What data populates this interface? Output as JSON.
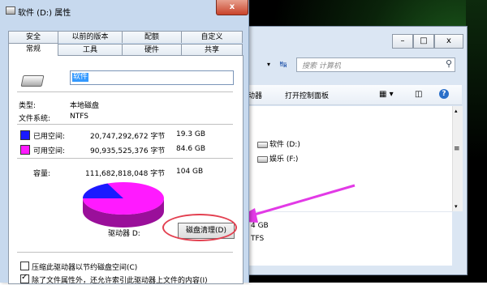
{
  "explorer": {
    "search_placeholder": "搜索 计算机",
    "controls": {
      "minimize": "–",
      "maximize": "□",
      "close": "x"
    },
    "address_dropdown": "▾",
    "refresh": "↹",
    "toolbar": {
      "partial_item": "动器",
      "control_panel": "打开控制面板"
    },
    "drives": [
      {
        "label": "软件 (D:)"
      },
      {
        "label": "娱乐 (F:)"
      }
    ],
    "details_pane": {
      "size_fragment": "4 GB",
      "fs_fragment": "TFS"
    }
  },
  "dialog": {
    "title": "软件 (D:) 属性",
    "close": "x",
    "tabs_top": [
      "安全",
      "以前的版本",
      "配额",
      "自定义"
    ],
    "tabs_bottom": [
      "常规",
      "工具",
      "硬件",
      "共享"
    ],
    "active_tab": "常规",
    "name_value": "软件",
    "type_label": "类型:",
    "type_value": "本地磁盘",
    "fs_label": "文件系统:",
    "fs_value": "NTFS",
    "used": {
      "label": "已用空间:",
      "bytes": "20,747,292,672 字节",
      "gb": "19.3 GB",
      "color": "#1a1aff"
    },
    "free": {
      "label": "可用空间:",
      "bytes": "90,935,525,376 字节",
      "gb": "84.6 GB",
      "color": "#ff1aff"
    },
    "capacity": {
      "label": "容量:",
      "bytes": "111,682,818,048 字节",
      "gb": "104 GB"
    },
    "drive_label": "驱动器 D:",
    "cleanup_button": "磁盘清理(D)",
    "used_fraction": 0.186,
    "checkbox_compress": "压缩此驱动器以节约磁盘空间(C)",
    "checkbox_index": "除了文件属性外，还允许索引此驱动器上文件的内容(I)"
  },
  "annotation_color": "#e34050",
  "arrow_color": "#e23ae6"
}
